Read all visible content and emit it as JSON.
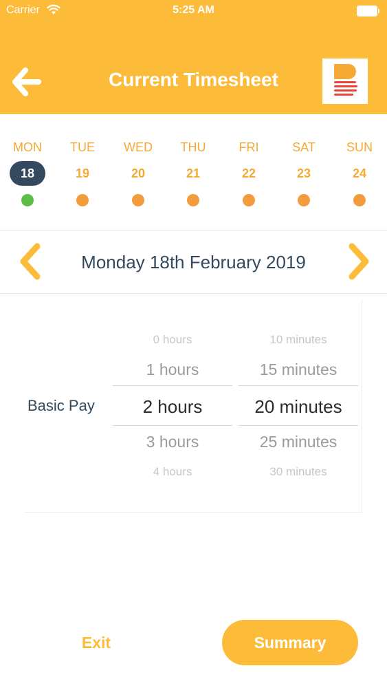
{
  "status_bar": {
    "carrier": "Carrier",
    "time": "5:25 AM"
  },
  "header": {
    "title": "Current Timesheet",
    "back_icon": "arrow-left-icon",
    "logo": "brand-logo"
  },
  "colors": {
    "primary": "#FDBB3A",
    "text_dark": "#34495E",
    "dot_done": "#5CBE47",
    "dot_pending": "#F39C3D"
  },
  "week": {
    "days": [
      {
        "name": "MON",
        "date": "18",
        "selected": true
      },
      {
        "name": "TUE",
        "date": "19",
        "selected": false
      },
      {
        "name": "WED",
        "date": "20",
        "selected": false
      },
      {
        "name": "THU",
        "date": "21",
        "selected": false
      },
      {
        "name": "FRI",
        "date": "22",
        "selected": false
      },
      {
        "name": "SAT",
        "date": "23",
        "selected": false
      },
      {
        "name": "SUN",
        "date": "24",
        "selected": false
      }
    ]
  },
  "date_nav": {
    "label": "Monday 18th February 2019",
    "prev_icon": "chevron-left-icon",
    "next_icon": "chevron-right-icon"
  },
  "entry": {
    "label": "Basic Pay",
    "hours_options": [
      "0 hours",
      "1 hours",
      "2 hours",
      "3 hours",
      "4 hours"
    ],
    "hours_selected": "2 hours",
    "minutes_options": [
      "10 minutes",
      "15 minutes",
      "20 minutes",
      "25 minutes",
      "30 minutes"
    ],
    "minutes_selected": "20 minutes"
  },
  "footer": {
    "exit_label": "Exit",
    "summary_label": "Summary"
  }
}
